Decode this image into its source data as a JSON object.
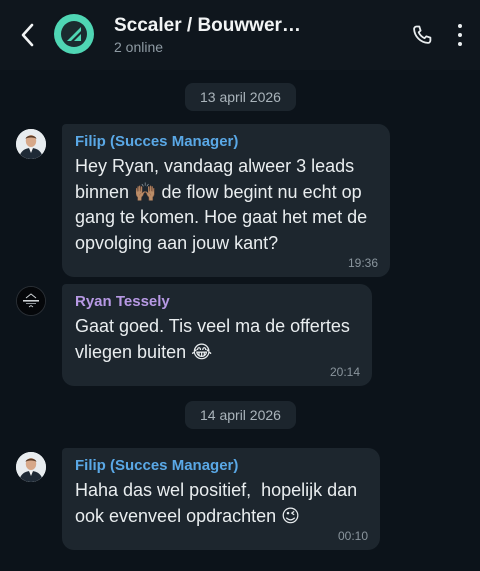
{
  "header": {
    "title": "Sccaler / Bouwwer…",
    "subtitle": "2 online"
  },
  "dates": [
    "13 april 2026",
    "14 april 2026"
  ],
  "messages": [
    {
      "sender": "Filip (Succes Manager)",
      "text": "Hey Ryan, vandaag alweer 3 leads\nbinnen 🙌🏽 de flow begint nu echt op\ngang te komen. Hoe gaat het met de\nopvolging aan jouw kant?",
      "time": "19:36"
    },
    {
      "sender": "Ryan Tessely",
      "text": "Gaat goed. Tis veel ma de offertes\nvliegen buiten 😂",
      "time": "20:14"
    },
    {
      "sender": "Filip (Succes Manager)",
      "text": "Haha das wel positief,  hopelijk dan\nook evenveel opdrachten 😉",
      "time": "00:10"
    }
  ],
  "colors": {
    "background": "#0c131a",
    "bubble": "#1d262e",
    "sender_filip": "#5aa8e6",
    "sender_ryan": "#b799e4",
    "group_avatar": "#4fd6b4"
  },
  "icons": {
    "back": "chevron-left-icon",
    "call": "phone-icon",
    "menu": "more-vertical-icon"
  }
}
